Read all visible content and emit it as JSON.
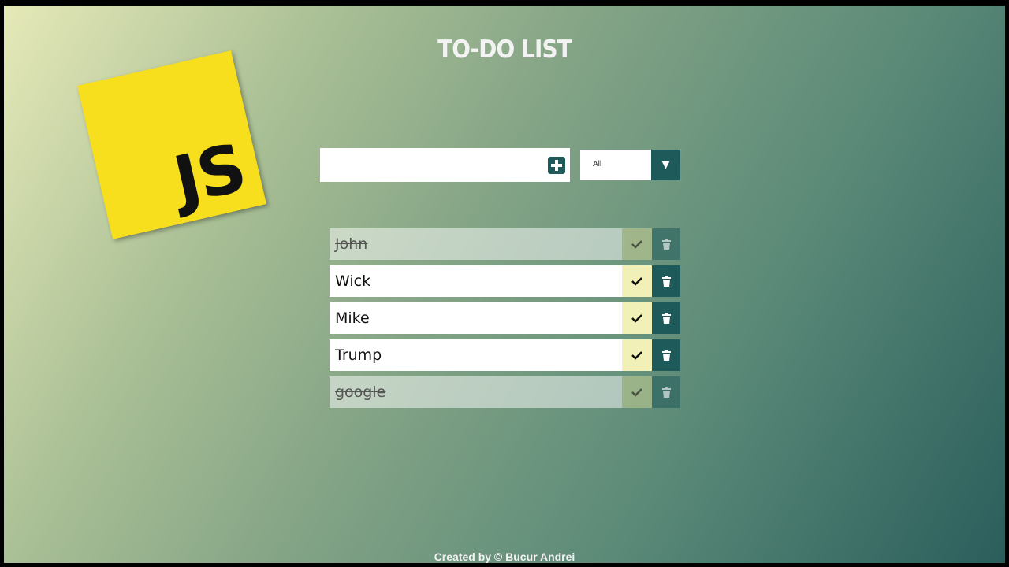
{
  "app": {
    "title": "TO-DO LIST"
  },
  "logo": {
    "text": "JS",
    "color": "#f7df1e"
  },
  "input": {
    "value": "",
    "placeholder": ""
  },
  "filter": {
    "selected": "All"
  },
  "todos": [
    {
      "text": "John",
      "completed": true
    },
    {
      "text": "Wick",
      "completed": false
    },
    {
      "text": "Mike",
      "completed": false
    },
    {
      "text": "Trump",
      "completed": false
    },
    {
      "text": "google",
      "completed": true
    }
  ],
  "footer": {
    "text": "Created by © Bucur Andrei"
  },
  "colors": {
    "accent": "#1f5a5a",
    "check": "#f0f0b8"
  },
  "icons": {
    "add": "plus-square-icon",
    "dropdown": "caret-down-icon",
    "check": "check-icon",
    "trash": "trash-icon"
  }
}
